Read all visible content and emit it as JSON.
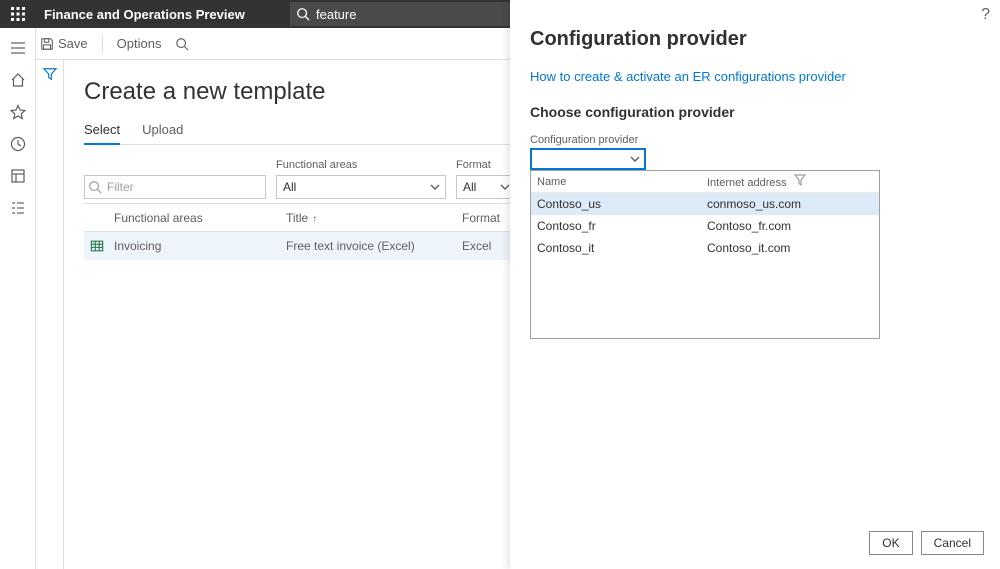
{
  "topbar": {
    "app_title": "Finance and Operations Preview",
    "search_value": "feature"
  },
  "cmdbar": {
    "save": "Save",
    "options": "Options"
  },
  "page": {
    "title": "Create a new template",
    "tabs": {
      "select": "Select",
      "upload": "Upload"
    },
    "filter_placeholder": "Filter",
    "fa_label": "Functional areas",
    "fa_value": "All",
    "fmt_label": "Format",
    "fmt_value": "All",
    "grid": {
      "cols": {
        "fa": "Functional areas",
        "title": "Title",
        "fmt": "Format"
      },
      "rows": [
        {
          "fa": "Invoicing",
          "title": "Free text invoice (Excel)",
          "fmt": "Excel"
        }
      ]
    }
  },
  "panel": {
    "title": "Configuration provider",
    "link": "How to create & activate an ER configurations provider",
    "sub": "Choose configuration provider",
    "field_label": "Configuration provider",
    "lookup": {
      "cols": {
        "name": "Name",
        "addr": "Internet address"
      },
      "rows": [
        {
          "name": "Contoso_us",
          "addr": "conmoso_us.com",
          "selected": true
        },
        {
          "name": "Contoso_fr",
          "addr": "Contoso_fr.com",
          "selected": false
        },
        {
          "name": "Contoso_it",
          "addr": "Contoso_it.com",
          "selected": false
        }
      ]
    },
    "buttons": {
      "ok": "OK",
      "cancel": "Cancel"
    }
  }
}
